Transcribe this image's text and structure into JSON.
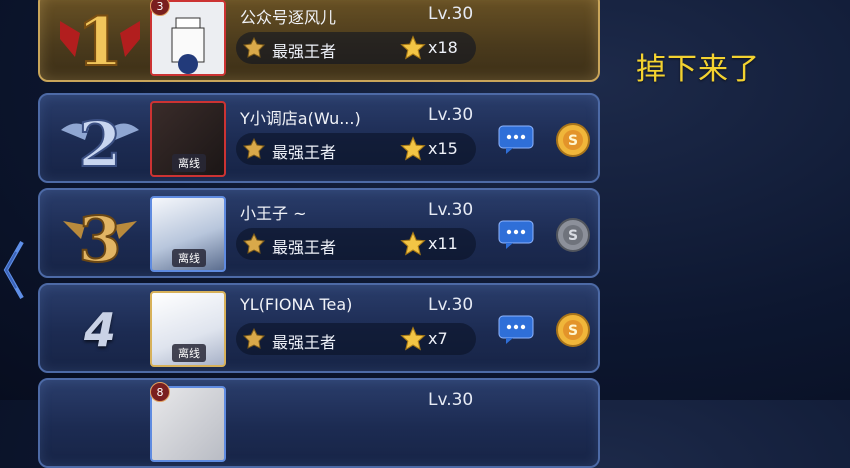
{
  "caption": "掉下来了",
  "players": [
    {
      "rank": "1",
      "name": "公众号逐风儿",
      "level": "Lv.30",
      "tier": "最强王者",
      "stars": "x18",
      "badge": "3",
      "offline": ""
    },
    {
      "rank": "2",
      "name": "Y小调店a(Wu...)",
      "level": "Lv.30",
      "tier": "最强王者",
      "stars": "x15",
      "badge": "",
      "offline": "离线"
    },
    {
      "rank": "3",
      "name": "小王子 ~",
      "level": "Lv.30",
      "tier": "最强王者",
      "stars": "x11",
      "badge": "",
      "offline": "离线"
    },
    {
      "rank": "4",
      "name": "YL(FIONA Tea)",
      "level": "Lv.30",
      "tier": "最强王者",
      "stars": "x7",
      "badge": "",
      "offline": "离线"
    },
    {
      "rank": "",
      "name": "",
      "level": "Lv.30",
      "tier": "",
      "stars": "",
      "badge": "8",
      "offline": ""
    }
  ],
  "icons": {
    "chat": "chat-bubble-icon",
    "gift": "coin-gift-icon",
    "tier": "king-tier-icon",
    "star": "star-icon",
    "back": "chevron-left-icon"
  },
  "colors": {
    "gold": "#f3d230",
    "frame_blue": "#4d6aa6",
    "frame_gold": "#c9a55a",
    "chat_blue": "#2f6fd8"
  }
}
